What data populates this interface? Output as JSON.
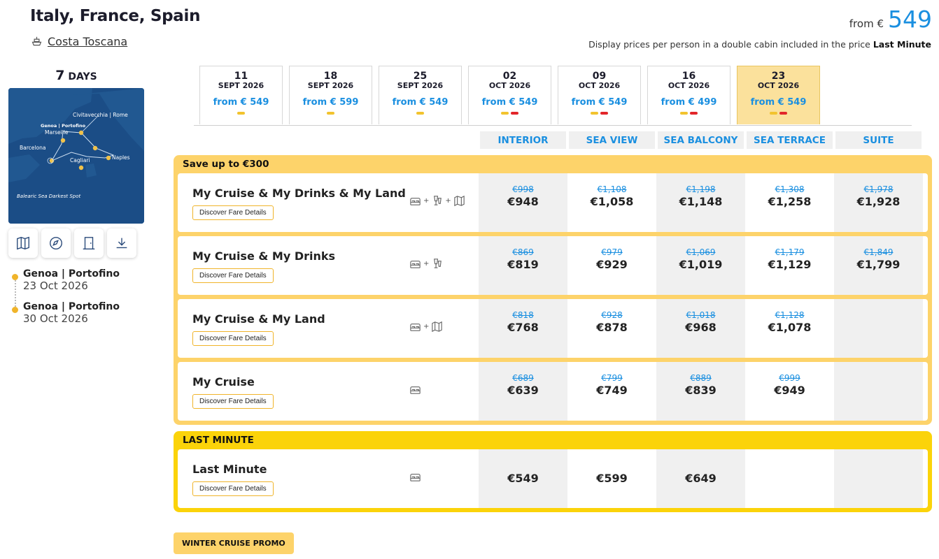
{
  "header": {
    "title": "Italy, France, Spain",
    "ship": "Costa Toscana",
    "from_label": "from €",
    "from_price": "549",
    "note_prefix": "Display prices per person in a double cabin included in the price",
    "note_strong": "Last Minute"
  },
  "side": {
    "days_num": "7",
    "days_label": "DAYS",
    "map_labels": {
      "civitavecchia": "Civitavecchia | Rome",
      "genoa": "Genoa | Portofino",
      "marseille": "Marseille",
      "barcelona": "Barcelona",
      "naples": "Naples",
      "cagliari": "Cagliari",
      "balearic": "Balearic Sea Darkest Spot"
    },
    "tools": [
      "map-icon",
      "compass-icon",
      "door-icon",
      "download-icon"
    ],
    "itinerary": [
      {
        "port": "Genoa | Portofino",
        "date": "23 Oct 2026"
      },
      {
        "port": "Genoa | Portofino",
        "date": "30 Oct 2026"
      }
    ]
  },
  "dates": [
    {
      "day": "11",
      "month": "SEPT 2026",
      "price": "from € 549",
      "marks": [
        "y"
      ]
    },
    {
      "day": "18",
      "month": "SEPT 2026",
      "price": "from € 599",
      "marks": [
        "y"
      ]
    },
    {
      "day": "25",
      "month": "SEPT 2026",
      "price": "from € 549",
      "marks": [
        "y"
      ]
    },
    {
      "day": "02",
      "month": "OCT 2026",
      "price": "from € 549",
      "marks": [
        "y",
        "r"
      ]
    },
    {
      "day": "09",
      "month": "OCT 2026",
      "price": "from € 549",
      "marks": [
        "y",
        "r"
      ]
    },
    {
      "day": "16",
      "month": "OCT 2026",
      "price": "from € 499",
      "marks": [
        "y",
        "r"
      ]
    },
    {
      "day": "23",
      "month": "OCT 2026",
      "price": "from € 549",
      "marks": [
        "y",
        "r"
      ],
      "active": true
    }
  ],
  "categories": [
    "INTERIOR",
    "SEA VIEW",
    "SEA BALCONY",
    "SEA TERRACE",
    "SUITE"
  ],
  "groups": [
    {
      "title": "Save up to €300",
      "rows": [
        {
          "name": "My Cruise & My Drinks & My Land",
          "btn": "Discover Fare Details",
          "incl": [
            "bed-icon",
            "drink-icon",
            "map-icon"
          ],
          "prices": [
            {
              "old": "€998",
              "new": "€948"
            },
            {
              "old": "€1,108",
              "new": "€1,058"
            },
            {
              "old": "€1,198",
              "new": "€1,148"
            },
            {
              "old": "€1,308",
              "new": "€1,258"
            },
            {
              "old": "€1,978",
              "new": "€1,928"
            }
          ]
        },
        {
          "name": "My Cruise & My Drinks",
          "btn": "Discover Fare Details",
          "incl": [
            "bed-icon",
            "drink-icon"
          ],
          "prices": [
            {
              "old": "€869",
              "new": "€819"
            },
            {
              "old": "€979",
              "new": "€929"
            },
            {
              "old": "€1,069",
              "new": "€1,019"
            },
            {
              "old": "€1,179",
              "new": "€1,129"
            },
            {
              "old": "€1,849",
              "new": "€1,799"
            }
          ]
        },
        {
          "name": "My Cruise & My Land",
          "btn": "Discover Fare Details",
          "incl": [
            "bed-icon",
            "map-icon"
          ],
          "prices": [
            {
              "old": "€818",
              "new": "€768"
            },
            {
              "old": "€928",
              "new": "€878"
            },
            {
              "old": "€1,018",
              "new": "€968"
            },
            {
              "old": "€1,128",
              "new": "€1,078"
            },
            null
          ]
        },
        {
          "name": "My Cruise",
          "btn": "Discover Fare Details",
          "incl": [
            "bed-icon"
          ],
          "prices": [
            {
              "old": "€689",
              "new": "€639"
            },
            {
              "old": "€799",
              "new": "€749"
            },
            {
              "old": "€889",
              "new": "€839"
            },
            {
              "old": "€999",
              "new": "€949"
            },
            null
          ]
        }
      ]
    },
    {
      "title": "LAST MINUTE",
      "rows": [
        {
          "name": "Last Minute",
          "btn": "Discover Fare Details",
          "incl": [
            "bed-icon"
          ],
          "prices": [
            {
              "new": "€549"
            },
            {
              "new": "€599"
            },
            {
              "new": "€649"
            },
            null,
            null
          ]
        }
      ]
    }
  ],
  "promo": "WINTER CRUISE PROMO",
  "colors": {
    "accent": "#1a8fe0",
    "promo_yellow": "#fdd36a",
    "last_minute_yellow": "#fbd30a",
    "marker_red": "#e2262a"
  }
}
